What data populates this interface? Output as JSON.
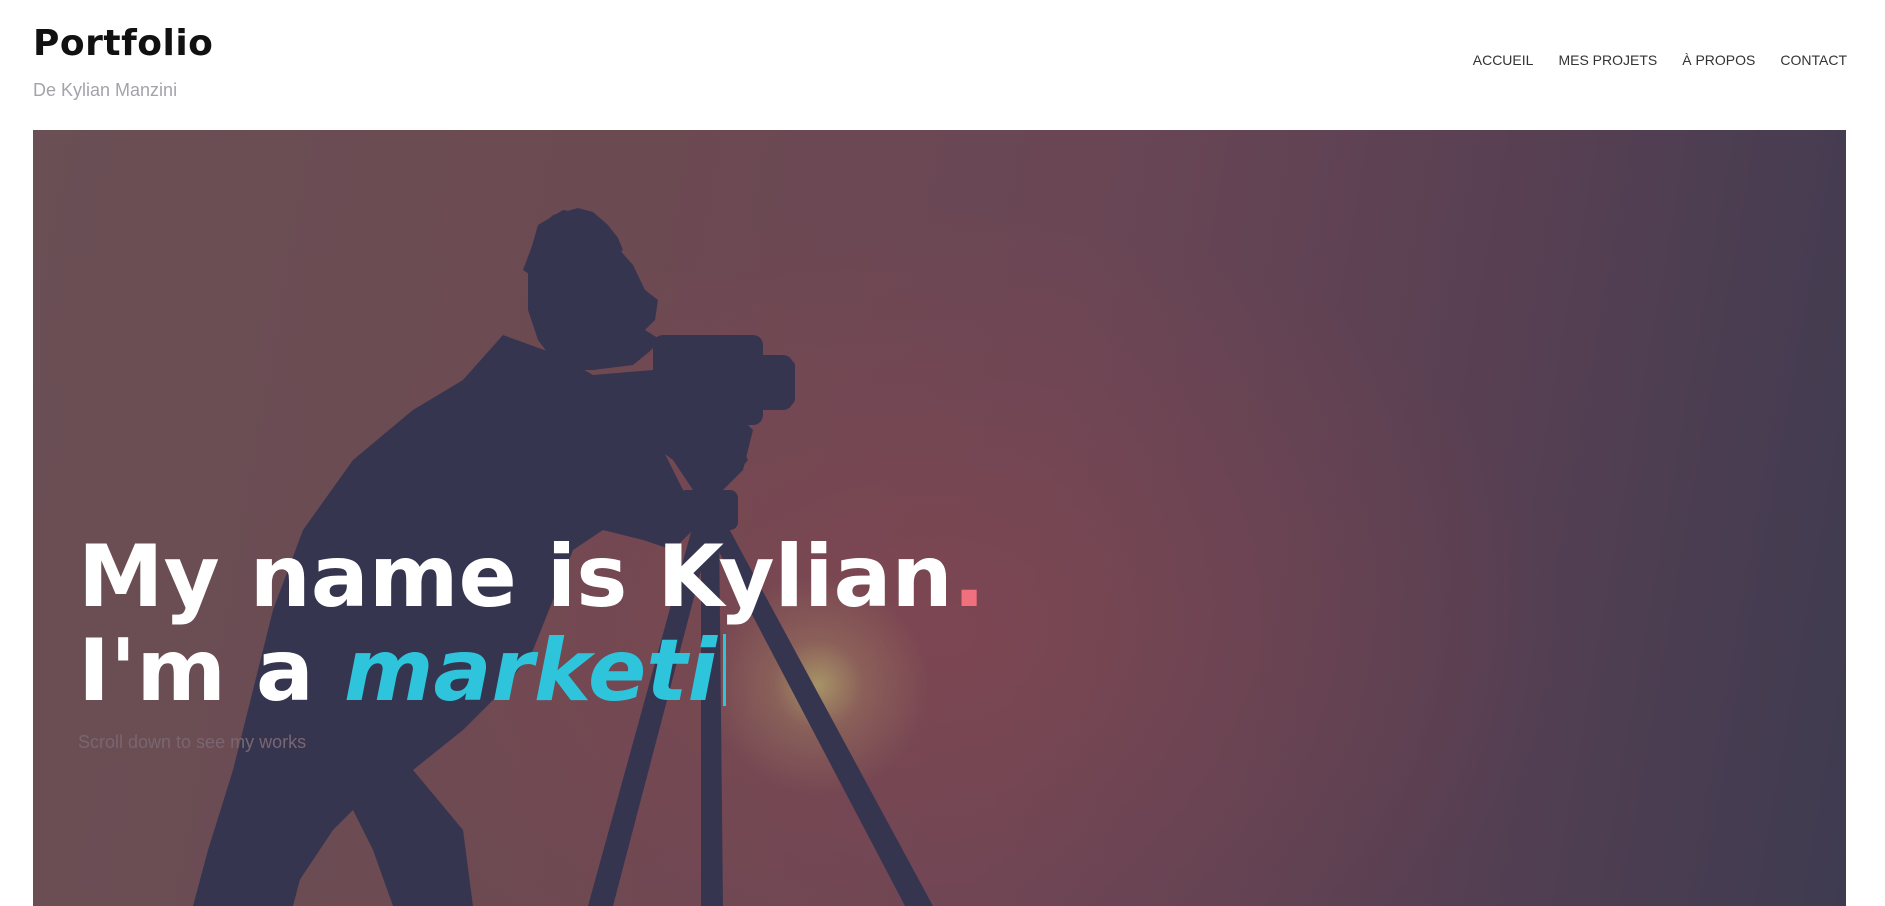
{
  "header": {
    "site_title": "Portfolio",
    "tagline": "De Kylian Manzini",
    "nav": [
      {
        "label": "ACCUEIL"
      },
      {
        "label": "MES PROJETS"
      },
      {
        "label": "À PROPOS"
      },
      {
        "label": "CONTACT"
      }
    ]
  },
  "hero": {
    "line1": "My name is Kylian",
    "line1_dot": ".",
    "line2_prefix": "I'm a",
    "typed_role": "marketi",
    "subtext": "Scroll down to see my works"
  },
  "colors": {
    "accent_cyan": "#2ec5dc",
    "accent_pink": "#f0717d"
  }
}
